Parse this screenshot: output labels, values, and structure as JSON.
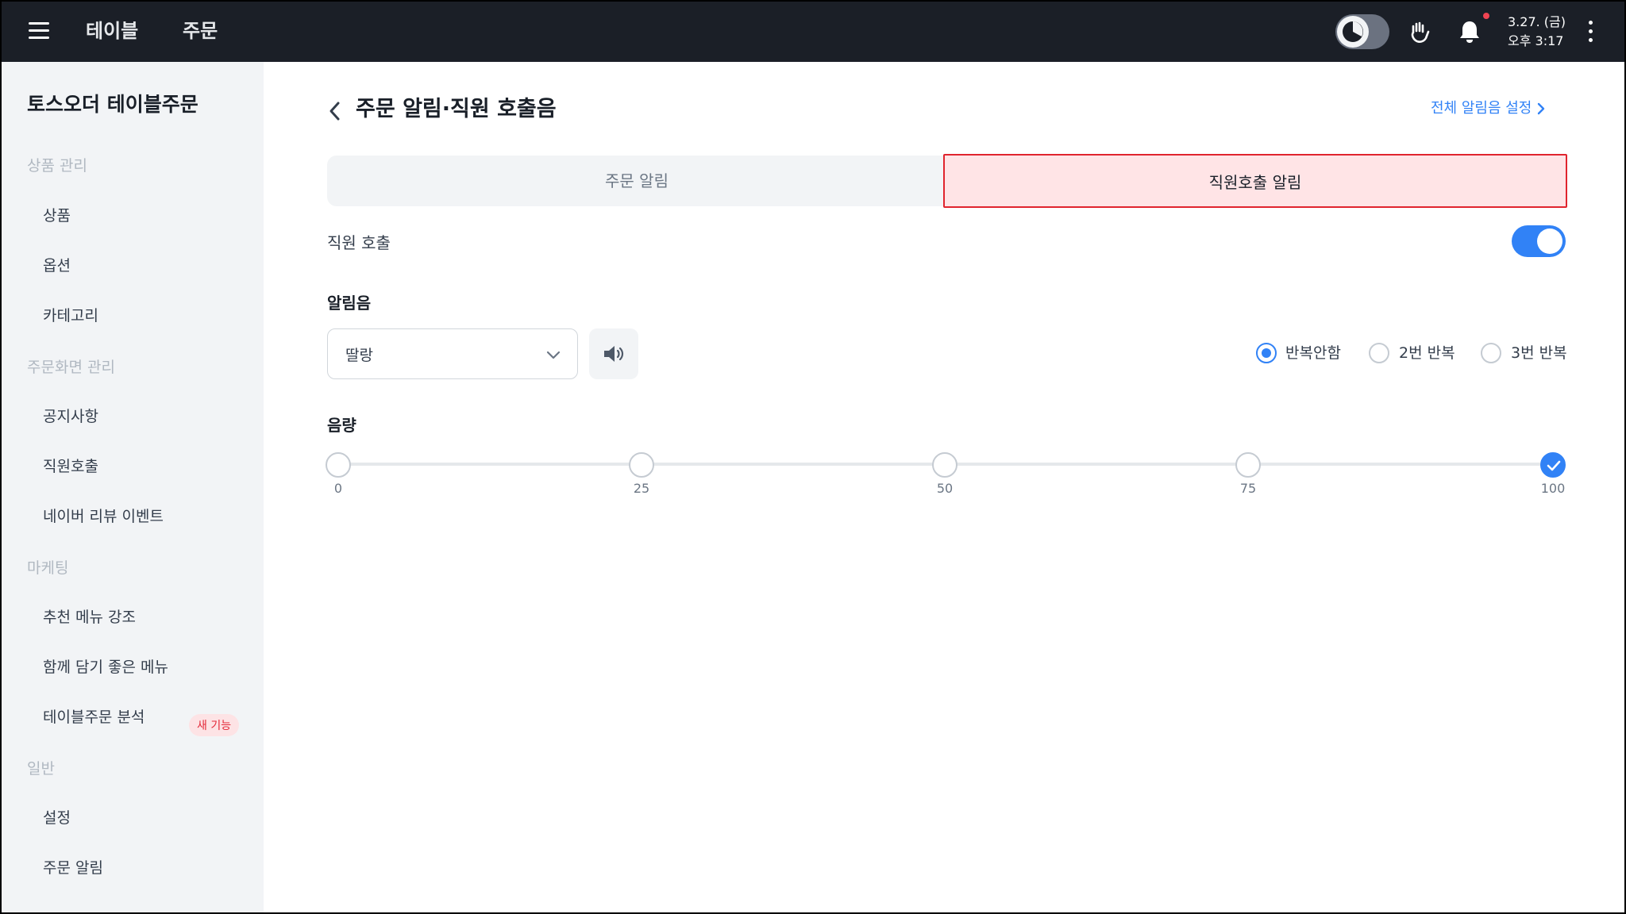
{
  "topbar": {
    "nav": [
      "테이블",
      "주문"
    ],
    "date": "3.27. (금)",
    "time": "오후 3:17"
  },
  "sidebar": {
    "brand": "토스오더 테이블주문",
    "sections": [
      {
        "title": "상품 관리",
        "items": [
          "상품",
          "옵션",
          "카테고리"
        ]
      },
      {
        "title": "주문화면 관리",
        "items": [
          "공지사항",
          "직원호출",
          "네이버 리뷰 이벤트"
        ]
      },
      {
        "title": "마케팅",
        "items": [
          "추천 메뉴 강조",
          "함께 담기 좋은 메뉴",
          "테이블주문 분석"
        ]
      },
      {
        "title": "일반",
        "items": [
          "설정",
          "주문 알림"
        ]
      }
    ],
    "new_badge": "새 기능"
  },
  "main": {
    "title": "주문 알림·직원 호출음",
    "all_settings_link": "전체 알림음 설정",
    "tabs": [
      {
        "label": "주문 알림",
        "active": false
      },
      {
        "label": "직원호출 알림",
        "active": true
      }
    ],
    "staff_call": {
      "label": "직원 호출",
      "enabled": true
    },
    "sound": {
      "label": "알림음",
      "selected": "딸랑",
      "repeat_options": [
        "반복안함",
        "2번 반복",
        "3번 반복"
      ],
      "repeat_selected": "반복안함"
    },
    "volume": {
      "label": "음량",
      "stops": [
        "0",
        "25",
        "50",
        "75",
        "100"
      ],
      "value": 100
    }
  },
  "colors": {
    "accent": "#3182f6",
    "topbar": "#1b1f27",
    "sidebar": "#f2f4f6",
    "highlight_border": "#e0242e",
    "highlight_fill": "#ffe4e6"
  }
}
